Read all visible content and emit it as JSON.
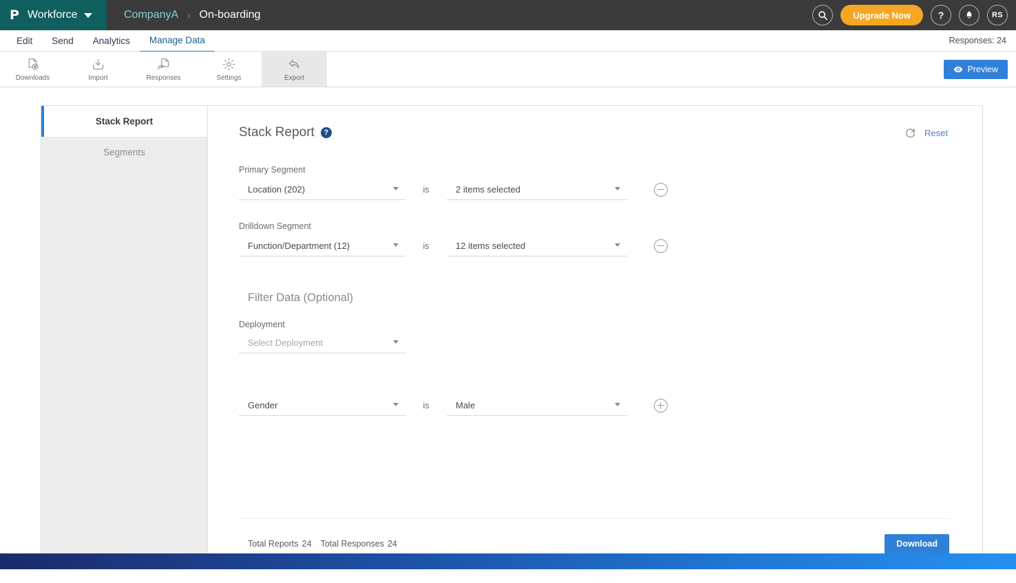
{
  "header": {
    "logo_glyph": "P",
    "brand": "Workforce",
    "breadcrumb": {
      "company": "CompanyA",
      "separator": "›",
      "current": "On-boarding"
    },
    "search_icon": "search-icon",
    "upgrade_label": "Upgrade Now",
    "help_glyph": "?",
    "bell_glyph": "A",
    "avatar_initials": "RS",
    "brand_color": "#0f5f5f",
    "bar_color": "#3b3b3b",
    "upgrade_color": "#f5a623"
  },
  "nav": {
    "items": [
      {
        "label": "Edit",
        "active": false
      },
      {
        "label": "Send",
        "active": false
      },
      {
        "label": "Analytics",
        "active": false
      },
      {
        "label": "Manage Data",
        "active": true
      }
    ],
    "responses_text": "Responses: 24"
  },
  "toolbar": {
    "items": [
      {
        "label": "Downloads",
        "icon": "document-download-icon",
        "active": false
      },
      {
        "label": "Import",
        "icon": "import-tray-icon",
        "active": false
      },
      {
        "label": "Responses",
        "icon": "responses-hand-icon",
        "active": false
      },
      {
        "label": "Settings",
        "icon": "gear-icon",
        "active": false
      },
      {
        "label": "Export",
        "icon": "export-share-arrow-icon",
        "active": true
      }
    ],
    "preview_label": "Preview",
    "preview_icon": "eye-icon",
    "preview_color": "#2f80d8"
  },
  "sidebar": {
    "items": [
      {
        "label": "Stack Report",
        "active": true
      },
      {
        "label": "Segments",
        "active": false
      }
    ],
    "active_accent": "#2f7fd8"
  },
  "main": {
    "title": "Stack Report",
    "help_glyph": "?",
    "reset_label": "Reset",
    "reset_icon": "refresh-icon",
    "reset_color": "#4a7fc1",
    "primary_segment": {
      "label": "Primary Segment",
      "field_value": "Location (202)",
      "operator": "is",
      "value": "2 items selected",
      "row_action": "remove"
    },
    "drilldown_segment": {
      "label": "Drilldown Segment",
      "field_value": "Function/Department (12)",
      "operator": "is",
      "value": "12 items selected",
      "row_action": "remove"
    },
    "filter_section": {
      "heading": "Filter Data (Optional)",
      "deployment_label": "Deployment",
      "deployment_placeholder": "Select Deployment",
      "gender_field": "Gender",
      "gender_operator": "is",
      "gender_value": "Male",
      "row_action": "add"
    },
    "footer": {
      "total_reports_label": "Total Reports",
      "total_reports_value": "24",
      "total_responses_label": "Total Responses",
      "total_responses_value": "24",
      "download_label": "Download"
    }
  }
}
